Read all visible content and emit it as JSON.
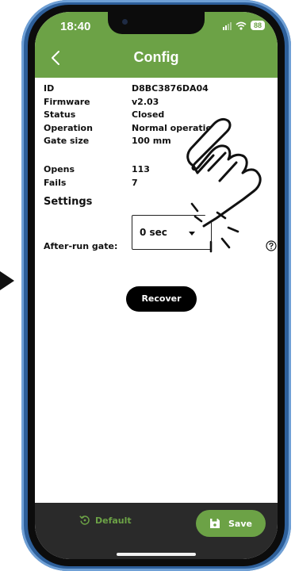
{
  "status_bar": {
    "time": "18:40",
    "battery": "88"
  },
  "header": {
    "title": "Config"
  },
  "device_info": [
    {
      "label": "ID",
      "value": "D8BC3876DA04"
    },
    {
      "label": "Firmware",
      "value": "v2.03"
    },
    {
      "label": "Status",
      "value": "Closed"
    },
    {
      "label": "Operation",
      "value": "Normal operation"
    },
    {
      "label": "Gate size",
      "value": "100 mm"
    }
  ],
  "counts": [
    {
      "label": "Opens",
      "value": "113"
    },
    {
      "label": "Fails",
      "value": "7"
    }
  ],
  "settings": {
    "heading": "Settings",
    "after_run_label": "After-run gate:",
    "after_run_value": "0 sec"
  },
  "actions": {
    "recover": "Recover"
  },
  "footer": {
    "default_label": "Default",
    "save_label": "Save"
  },
  "colors": {
    "accent": "#6ca246",
    "footer_bg": "#2a2a2a",
    "frame": "#2d5f9a"
  }
}
